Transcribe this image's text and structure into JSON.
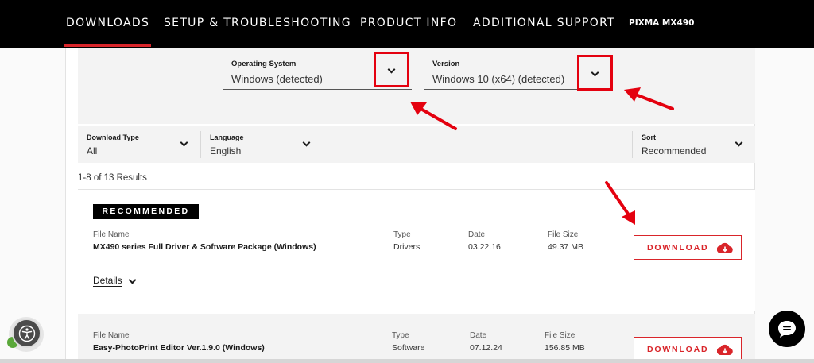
{
  "nav": {
    "items": [
      {
        "label": "DOWNLOADS"
      },
      {
        "label": "SETUP & TROUBLESHOOTING"
      },
      {
        "label": "PRODUCT INFO"
      },
      {
        "label": "ADDITIONAL SUPPORT"
      }
    ],
    "model": "PIXMA MX490"
  },
  "os_select": {
    "label": "Operating System",
    "value": "Windows (detected)"
  },
  "version_select": {
    "label": "Version",
    "value": "Windows 10 (x64) (detected)"
  },
  "filters": {
    "download_type": {
      "label": "Download Type",
      "value": "All"
    },
    "language": {
      "label": "Language",
      "value": "English"
    },
    "sort": {
      "label": "Sort",
      "value": "Recommended"
    }
  },
  "results_count": "1-8 of 13 Results",
  "columns": {
    "file_name": "File Name",
    "type": "Type",
    "date": "Date",
    "file_size": "File Size"
  },
  "downloads": [
    {
      "badge": "RECOMMENDED",
      "file_name": "MX490 series Full Driver & Software Package (Windows)",
      "type": "Drivers",
      "date": "03.22.16",
      "file_size": "49.37 MB",
      "button": "DOWNLOAD",
      "details": "Details"
    },
    {
      "file_name": "Easy-PhotoPrint Editor Ver.1.9.0 (Windows)",
      "type": "Software",
      "date": "07.12.24",
      "file_size": "156.85 MB",
      "button": "DOWNLOAD"
    }
  ],
  "colors": {
    "accent": "#d9252a",
    "highlight": "#e4010f",
    "nav_bg": "#000000"
  },
  "icons": [
    "chevron-down-icon",
    "cloud-download-icon",
    "accessibility-icon",
    "chat-icon"
  ]
}
